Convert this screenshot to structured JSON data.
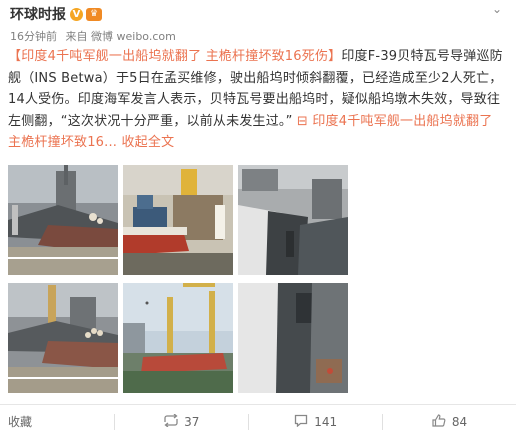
{
  "post": {
    "author": "环球时报",
    "verified_badge": "V",
    "time": "16分钟前",
    "source": "来自 微博 weibo.com",
    "text_before_topic": "",
    "topic": "【印度4千吨军舰一出船坞就翻了 主桅杆撞坏致16死伤】",
    "body": "印度F-39贝特瓦号导弹巡防舰（INS Betwa）于5日在孟买维修，驶出船坞时倾斜翻覆，已经造成至少2人死亡，14人受伤。印度海军发言人表示，贝特瓦号要出船坞时，疑似船坞墩木失效，导致往左侧翻，“这次状况十分严重，以前从未发生过。”",
    "link_text": "印度4千吨军舰一出船坞就翻了 主桅杆撞坏致16...",
    "collapse_text": "收起全文",
    "images": [
      "docked-warship",
      "tugboat",
      "capsized-ship-hull",
      "warship-crowd",
      "crane-aerial",
      "hull-side"
    ]
  },
  "actions": {
    "favorite": "收藏",
    "repost_count": "37",
    "comment_count": "141",
    "like_count": "84"
  },
  "colors": {
    "link": "#eb7350",
    "verified": "#f5a623"
  }
}
